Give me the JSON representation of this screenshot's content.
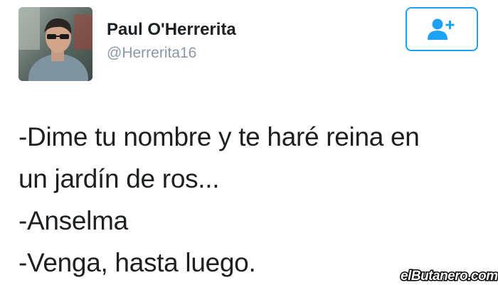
{
  "tweet": {
    "author": {
      "display_name": "Paul O'Herrerita",
      "handle": "@Herrerita16",
      "avatar_icon": "profile-photo"
    },
    "follow_button": {
      "icon": "add-user-icon",
      "color": "#1da1f2"
    },
    "text_lines": [
      "-Dime tu nombre y te haré reina en",
      "un jardín de ros...",
      "-Anselma",
      "-Venga, hasta luego."
    ]
  },
  "watermark": {
    "text": "elButanero.com"
  }
}
